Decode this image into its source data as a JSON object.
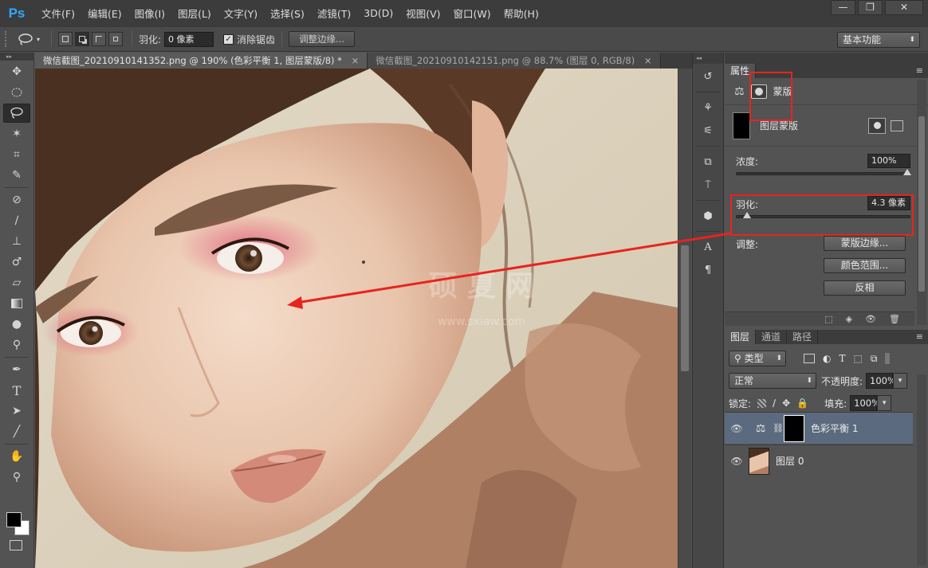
{
  "menu": {
    "logo": "Ps",
    "items": [
      "文件(F)",
      "编辑(E)",
      "图像(I)",
      "图层(L)",
      "文字(Y)",
      "选择(S)",
      "滤镜(T)",
      "3D(D)",
      "视图(V)",
      "窗口(W)",
      "帮助(H)"
    ],
    "window_controls": [
      "—",
      "❐",
      "✕"
    ]
  },
  "options": {
    "feather_label": "羽化:",
    "feather_value": "0 像素",
    "antialias_label": "消除锯齿",
    "antialias_checked": true,
    "refine_edge_label": "调整边缘...",
    "workspace_label": "基本功能"
  },
  "tabs": [
    {
      "label": "微信截图_20210910141352.png @ 190% (色彩平衡 1, 图层蒙版/8) *",
      "close": "×",
      "active": true
    },
    {
      "label": "微信截图_20210910142151.png @ 88.7% (图层 0, RGB/8)",
      "close": "×",
      "active": false
    }
  ],
  "canvas": {
    "watermark_main": "硕 夏 网",
    "watermark_url": "www.sxiaw.com"
  },
  "properties": {
    "tab_label": "属性",
    "mask_label": "蒙版",
    "layer_mask_label": "图层蒙版",
    "density_label": "浓度:",
    "density_value": "100%",
    "density_fraction": 1.0,
    "feather_label": "羽化:",
    "feather_value": "4.3 像素",
    "feather_fraction": 0.04,
    "refine_label": "调整:",
    "mask_edge_button": "蒙版边缘...",
    "color_range_button": "颜色范围...",
    "invert_button": "反相"
  },
  "layers": {
    "tabs": [
      "图层",
      "通道",
      "路径"
    ],
    "filter_kind": "类型",
    "blend_mode": "正常",
    "opacity_label": "不透明度:",
    "opacity_value": "100%",
    "lock_label": "锁定:",
    "fill_label": "填充:",
    "fill_value": "100%",
    "items": [
      {
        "name": "色彩平衡 1",
        "selected": true
      },
      {
        "name": "图层 0",
        "selected": false
      }
    ]
  },
  "colors": {
    "annotation": "#e8231f",
    "selection": "#5b6a7e",
    "ps_blue": "#31a8ff"
  }
}
